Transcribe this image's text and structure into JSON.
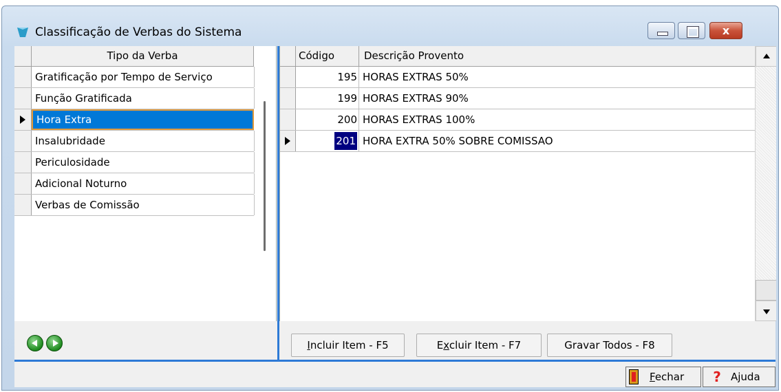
{
  "window": {
    "title": "Classificação de Verbas do Sistema",
    "close_glyph": "x"
  },
  "left_grid": {
    "header": "Tipo da Verba",
    "items": [
      {
        "label": "Gratificação por Tempo de Serviço"
      },
      {
        "label": "Função Gratificada"
      },
      {
        "label": "Hora Extra",
        "selected": true
      },
      {
        "label": "Insalubridade"
      },
      {
        "label": "Periculosidade"
      },
      {
        "label": "Adicional Noturno"
      },
      {
        "label": "Verbas de Comissão"
      }
    ]
  },
  "right_grid": {
    "headers": {
      "code": "Código",
      "description": "Descrição Provento"
    },
    "rows": [
      {
        "code": "195",
        "description": "HORAS EXTRAS 50%"
      },
      {
        "code": "199",
        "description": "HORAS EXTRAS 90%"
      },
      {
        "code": "200",
        "description": "HORAS EXTRAS 100%"
      },
      {
        "code": "201",
        "description": "HORA EXTRA 50% SOBRE COMISSAO",
        "selected": true
      }
    ]
  },
  "actions": {
    "incluir_prefix": "I",
    "incluir_rest": "ncluir Item - F5",
    "excluir_prefix": "E",
    "excluir_under": "x",
    "excluir_rest": "cluir Item - F7",
    "gravar": "Gravar Todos - F8"
  },
  "footer": {
    "fechar_under": "F",
    "fechar_rest": "echar",
    "ajuda": "Ajuda",
    "help_glyph": "?"
  },
  "colors": {
    "selection": "#0078d7",
    "selection_code": "#000080",
    "accent_divider": "#2d7ad6"
  }
}
